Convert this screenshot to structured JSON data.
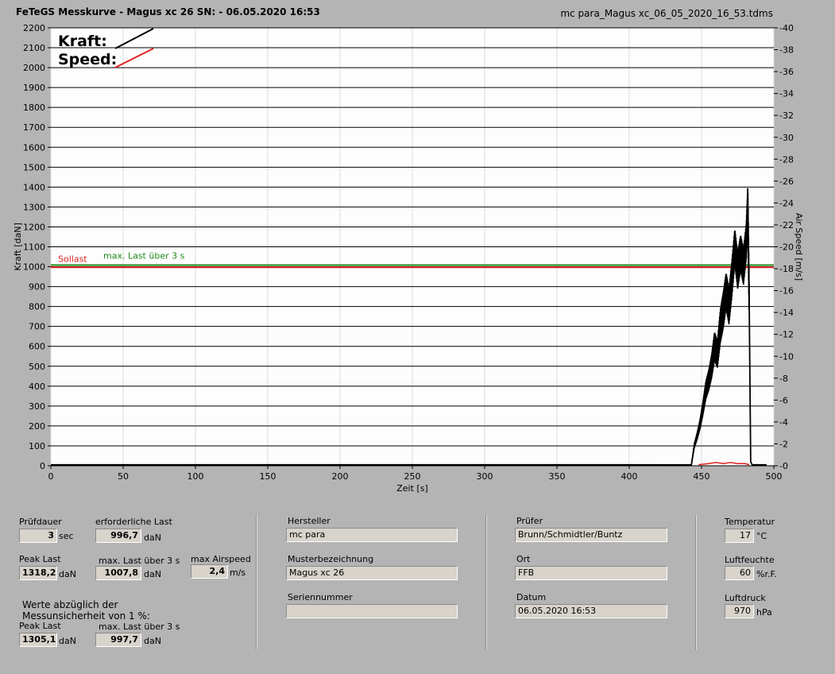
{
  "header": {
    "title": "FeTeGS Messkurve - Magus xc 26  SN:  - 06.05.2020 16:53",
    "filename": "mc para_Magus xc_06_05_2020_16_53.tdms"
  },
  "chart_data": {
    "type": "line",
    "xlabel": "Zeit [s]",
    "ylabel": "Kraft [daN]",
    "y2label": "Air Speed [m/s]",
    "xlim": [
      0,
      500
    ],
    "ylim": [
      0,
      2200
    ],
    "y2lim": [
      0,
      40
    ],
    "xticks": [
      "0",
      "50",
      "100",
      "150",
      "200",
      "250",
      "300",
      "350",
      "400",
      "450",
      "500"
    ],
    "yticks": [
      "0",
      "100",
      "200",
      "300",
      "400",
      "500",
      "600",
      "700",
      "800",
      "900",
      "1000",
      "1100",
      "1200",
      "1300",
      "1400",
      "1500",
      "1600",
      "1700",
      "1800",
      "1900",
      "2000",
      "2100",
      "2200"
    ],
    "y2ticks": [
      "0",
      "2",
      "4",
      "6",
      "8",
      "10",
      "12",
      "14",
      "16",
      "18",
      "20",
      "22",
      "24",
      "26",
      "28",
      "30",
      "32",
      "34",
      "36",
      "38",
      "40"
    ],
    "grid": true,
    "legend": [
      {
        "name": "Kraft:",
        "color": "#000000"
      },
      {
        "name": "Speed:",
        "color": "#e02020"
      }
    ],
    "reference_lines": [
      {
        "label": "Sollast",
        "value": 997,
        "color": "#e02020"
      },
      {
        "label": "max. Last über  3 s",
        "value": 1008,
        "color": "#1e8a1e"
      }
    ],
    "series": [
      {
        "name": "Kraft:",
        "color": "#000000",
        "x": [
          0,
          100,
          200,
          300,
          400,
          443,
          445,
          447,
          449,
          451,
          453,
          455,
          457,
          459,
          461,
          463,
          465,
          467,
          469,
          471,
          473,
          475,
          477,
          479,
          481,
          482,
          483,
          484,
          485,
          490,
          495
        ],
        "y": [
          5,
          5,
          5,
          5,
          5,
          5,
          100,
          150,
          210,
          290,
          380,
          430,
          500,
          600,
          560,
          700,
          780,
          880,
          800,
          940,
          1100,
          980,
          1070,
          1000,
          1130,
          1318,
          800,
          20,
          5,
          5,
          5
        ]
      },
      {
        "name": "Speed:",
        "color": "#e02020",
        "x": [
          448,
          455,
          460,
          465,
          470,
          475,
          480,
          483
        ],
        "y": [
          0.1,
          0.2,
          0.3,
          0.2,
          0.3,
          0.2,
          0.2,
          0.1
        ]
      }
    ]
  },
  "info": {
    "pruefdauer": {
      "label": "Prüfdauer",
      "value": "3",
      "unit": "sec"
    },
    "erforderliche_last": {
      "label": "erforderliche Last",
      "value": "996,7",
      "unit": "daN"
    },
    "peak_last": {
      "label": "Peak Last",
      "value": "1318,2",
      "unit": "daN"
    },
    "max_last": {
      "label": "max. Last über  3 s",
      "value": "1007,8",
      "unit": "daN"
    },
    "max_airspeed": {
      "label": "max Airspeed",
      "value": "2,4",
      "unit": "m/s"
    },
    "werte_text_1": "Werte abzüglich der",
    "werte_text_2": "Messunsicherheit von 1  %:",
    "peak_last_2": {
      "label": "Peak Last",
      "value": "1305,1",
      "unit": "daN"
    },
    "max_last_2": {
      "label": "max. Last über  3 s",
      "value": "997,7",
      "unit": "daN"
    }
  },
  "product": {
    "hersteller": {
      "label": "Hersteller",
      "value": "mc para"
    },
    "musterbezeichnung": {
      "label": "Musterbezeichnung",
      "value": "Magus xc 26"
    },
    "seriennummer": {
      "label": "Seriennummer",
      "value": ""
    }
  },
  "test": {
    "pruefer": {
      "label": "Prüfer",
      "value": "Brunn/Schmidtler/Buntz"
    },
    "ort": {
      "label": "Ort",
      "value": "FFB"
    },
    "datum": {
      "label": "Datum",
      "value": "06.05.2020 16:53"
    }
  },
  "env": {
    "temperatur": {
      "label": "Temperatur",
      "value": "17",
      "unit": "°C"
    },
    "luftfeuchte": {
      "label": "Luftfeuchte",
      "value": "60",
      "unit": "%r.F."
    },
    "luftdruck": {
      "label": "Luftdruck",
      "value": "970",
      "unit": "hPa"
    }
  }
}
